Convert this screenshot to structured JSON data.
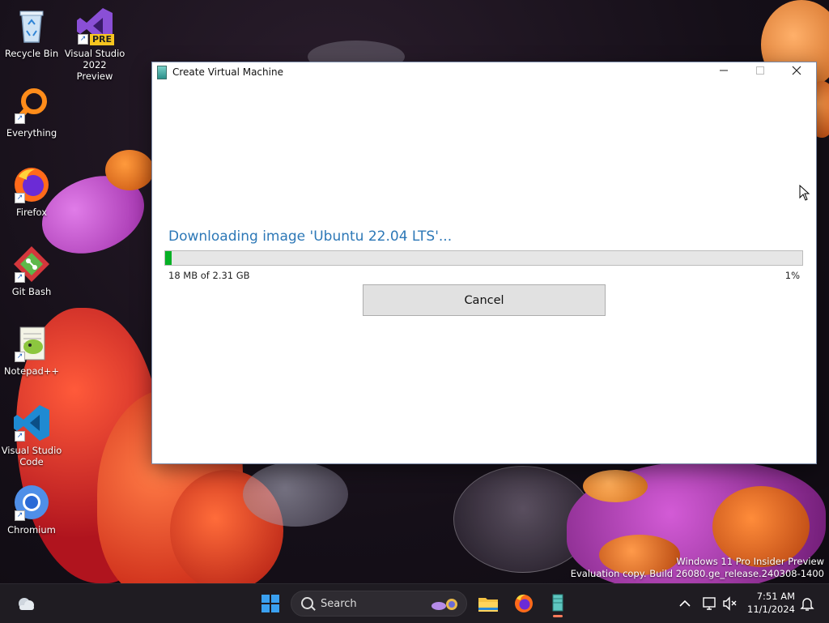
{
  "desktop": {
    "icons": [
      {
        "label": "Recycle Bin",
        "icon": "recycle-bin-icon"
      },
      {
        "label": "Visual Studio 2022 Preview",
        "icon": "visual-studio-icon",
        "badge": "PRE"
      },
      {
        "label": "Everything",
        "icon": "everything-icon"
      },
      {
        "label": "Firefox",
        "icon": "firefox-icon"
      },
      {
        "label": "Git Bash",
        "icon": "git-bash-icon"
      },
      {
        "label": "Notepad++",
        "icon": "notepad-plus-plus-icon"
      },
      {
        "label": "Visual Studio Code",
        "icon": "vscode-icon"
      },
      {
        "label": "Chromium",
        "icon": "chromium-icon"
      }
    ]
  },
  "window": {
    "title": "Create Virtual Machine",
    "status": "Downloading image 'Ubuntu 22.04 LTS'...",
    "downloaded": "18 MB of 2.31 GB",
    "percent_text": "1%",
    "progress_percent": 1,
    "cancel_label": "Cancel",
    "accent_color": "#2d78b7",
    "progress_color": "#06b025"
  },
  "watermark": {
    "line1": "Windows 11 Pro Insider Preview",
    "line2": "Evaluation copy. Build 26080.ge_release.240308-1400"
  },
  "taskbar": {
    "search_placeholder": "Search",
    "clock_time": "7:51 AM",
    "clock_date": "11/1/2024",
    "pinned": [
      "start-icon",
      "file-explorer-icon",
      "firefox-icon",
      "virtual-machine-app-icon"
    ]
  }
}
